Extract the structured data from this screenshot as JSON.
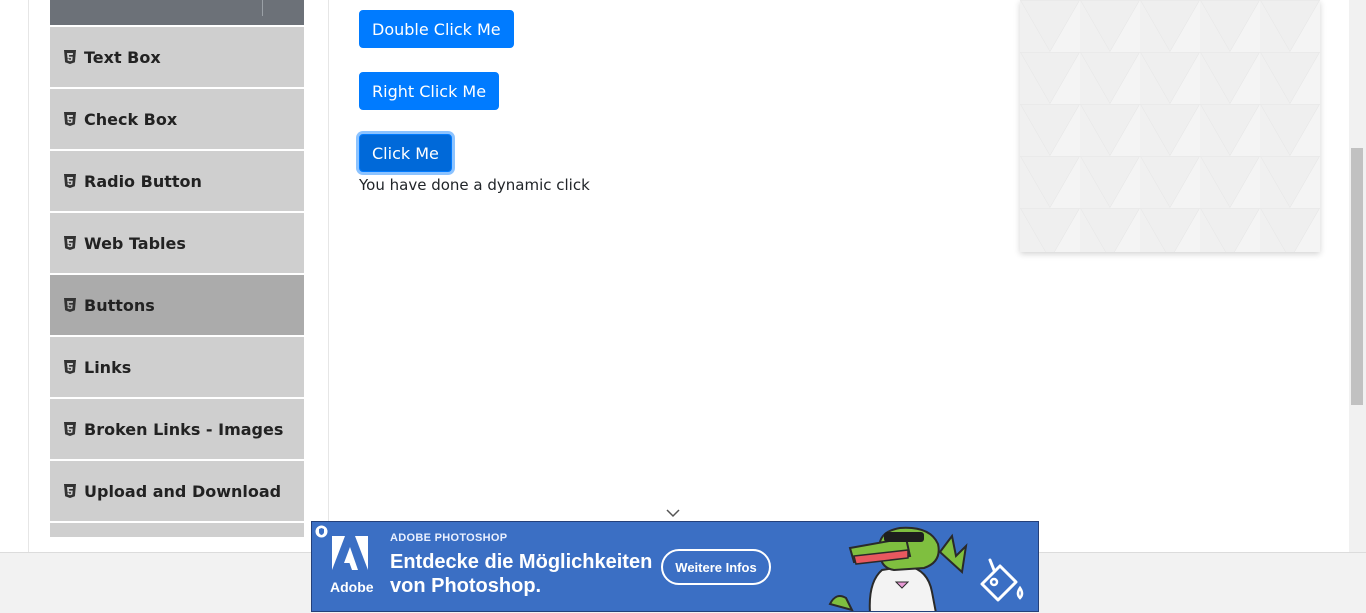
{
  "sidebar": {
    "items": [
      {
        "label": "Text Box",
        "icon": "html5-icon"
      },
      {
        "label": "Check Box",
        "icon": "html5-icon"
      },
      {
        "label": "Radio Button",
        "icon": "html5-icon"
      },
      {
        "label": "Web Tables",
        "icon": "html5-icon"
      },
      {
        "label": "Buttons",
        "icon": "html5-icon",
        "active": true
      },
      {
        "label": "Links",
        "icon": "html5-icon"
      },
      {
        "label": "Broken Links - Images",
        "icon": "html5-icon"
      },
      {
        "label": "Upload and Download",
        "icon": "html5-icon"
      }
    ]
  },
  "main": {
    "double_click_label": "Double Click Me",
    "right_click_label": "Right Click Me",
    "click_label": "Click Me",
    "dynamic_message": "You have done a dynamic click"
  },
  "ad": {
    "brand": "Adobe",
    "eyebrow": "ADOBE PHOTOSHOP",
    "headline": "Entdecke die Möglichkeiten von Photoshop.",
    "cta": "Weitere Infos"
  },
  "colors": {
    "primary": "#007bff",
    "sidebar_item_bg": "#cfcfcf",
    "sidebar_active_bg": "#ababab",
    "ad_bg": "#3b6fc4"
  }
}
